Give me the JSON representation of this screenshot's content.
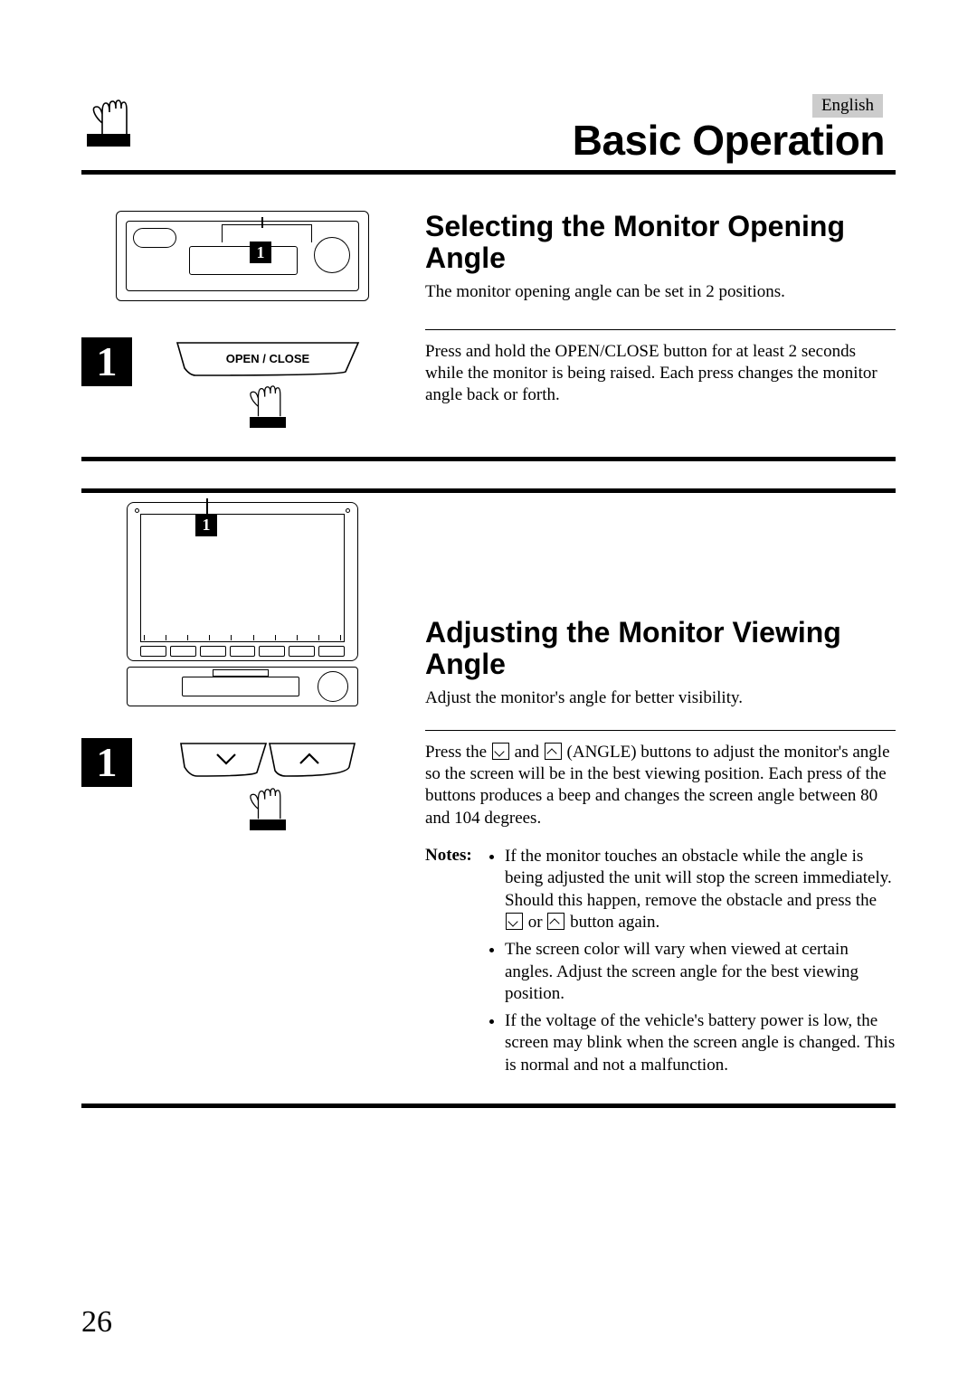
{
  "language": "English",
  "title": "Basic Operation",
  "page_number": "26",
  "section1": {
    "heading": "Selecting the Monitor Opening Angle",
    "intro": "The monitor opening angle can be set in 2 positions.",
    "step_num": "1",
    "button_label": "OPEN / CLOSE",
    "step_text": "Press and hold the OPEN/CLOSE button for at least 2 seconds while the monitor is being raised. Each press changes the monitor angle back or forth.",
    "callout": "1"
  },
  "section2": {
    "heading": "Adjusting the Monitor Viewing Angle",
    "intro": "Adjust the monitor's angle for better visibility.",
    "step_num": "1",
    "callout": "1",
    "step_text_pre": "Press the ",
    "step_text_mid": " and ",
    "step_text_post": " (ANGLE) buttons to adjust the monitor's angle so the screen will be in the best viewing position. Each press of the buttons produces a beep and changes the screen angle between 80 and 104 degrees.",
    "notes_label": "Notes:",
    "note1_pre": "If the monitor touches an obstacle while the angle is being adjusted the unit will stop the screen immediately. Should this happen, remove the obstacle and press the ",
    "note1_mid": " or ",
    "note1_post": " button again.",
    "note2": "The screen color will vary when viewed at certain angles. Adjust the screen angle for the best viewing position.",
    "note3": "If the voltage of the vehicle's battery power is low, the screen may blink when the screen angle is changed. This is normal and not a malfunction."
  }
}
